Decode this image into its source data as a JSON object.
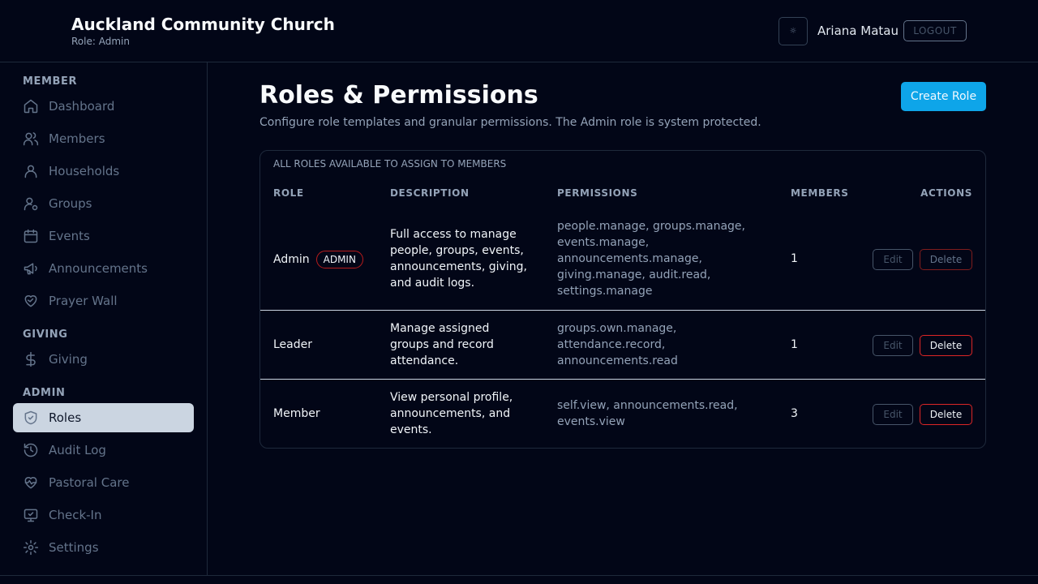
{
  "header": {
    "church_name": "Auckland Community Church",
    "role_label": "Role: Admin",
    "theme_icon": "☼",
    "user_name": "Ariana Matau",
    "logout_label": "LOGOUT"
  },
  "sidebar": {
    "sections": {
      "member": "MEMBER",
      "giving": "GIVING",
      "admin": "ADMIN"
    },
    "items": [
      {
        "label": "Dashboard",
        "icon": "home-icon"
      },
      {
        "label": "Members",
        "icon": "users-icon"
      },
      {
        "label": "Households",
        "icon": "user-icon"
      },
      {
        "label": "Groups",
        "icon": "user-gear-icon"
      },
      {
        "label": "Events",
        "icon": "calendar-icon"
      },
      {
        "label": "Announcements",
        "icon": "megaphone-icon"
      },
      {
        "label": "Prayer Wall",
        "icon": "heart-handshake-icon"
      },
      {
        "label": "Giving",
        "icon": "dollar-icon"
      },
      {
        "label": "Roles",
        "icon": "shield-icon",
        "active": true
      },
      {
        "label": "Audit Log",
        "icon": "history-icon"
      },
      {
        "label": "Pastoral Care",
        "icon": "heart-pulse-icon"
      },
      {
        "label": "Check-In",
        "icon": "monitor-check-icon"
      },
      {
        "label": "Settings",
        "icon": "gear-icon"
      }
    ]
  },
  "main": {
    "title": "Roles & Permissions",
    "subtitle": "Configure role templates and granular permissions. The Admin role is system protected.",
    "create_label": "Create Role",
    "table": {
      "caption": "ALL ROLES AVAILABLE TO ASSIGN TO MEMBERS",
      "headers": {
        "role": "ROLE",
        "description": "DESCRIPTION",
        "permissions": "PERMISSIONS",
        "members": "MEMBERS",
        "actions": "ACTIONS"
      },
      "rows": [
        {
          "role": "Admin",
          "badge": "ADMIN",
          "description": "Full access to manage people, groups, events, announcements, giving, and audit logs.",
          "permissions": "people.manage, groups.manage, events.manage, announcements.manage, giving.manage, audit.read, settings.manage",
          "members": "1",
          "edit": "Edit",
          "delete": "Delete"
        },
        {
          "role": "Leader",
          "description": "Manage assigned groups and record attendance.",
          "permissions": "groups.own.manage, attendance.record, announcements.read",
          "members": "1",
          "edit": "Edit",
          "delete": "Delete"
        },
        {
          "role": "Member",
          "description": "View personal profile, announcements, and events.",
          "permissions": "self.view, announcements.read, events.view",
          "members": "3",
          "edit": "Edit",
          "delete": "Delete"
        }
      ]
    }
  }
}
